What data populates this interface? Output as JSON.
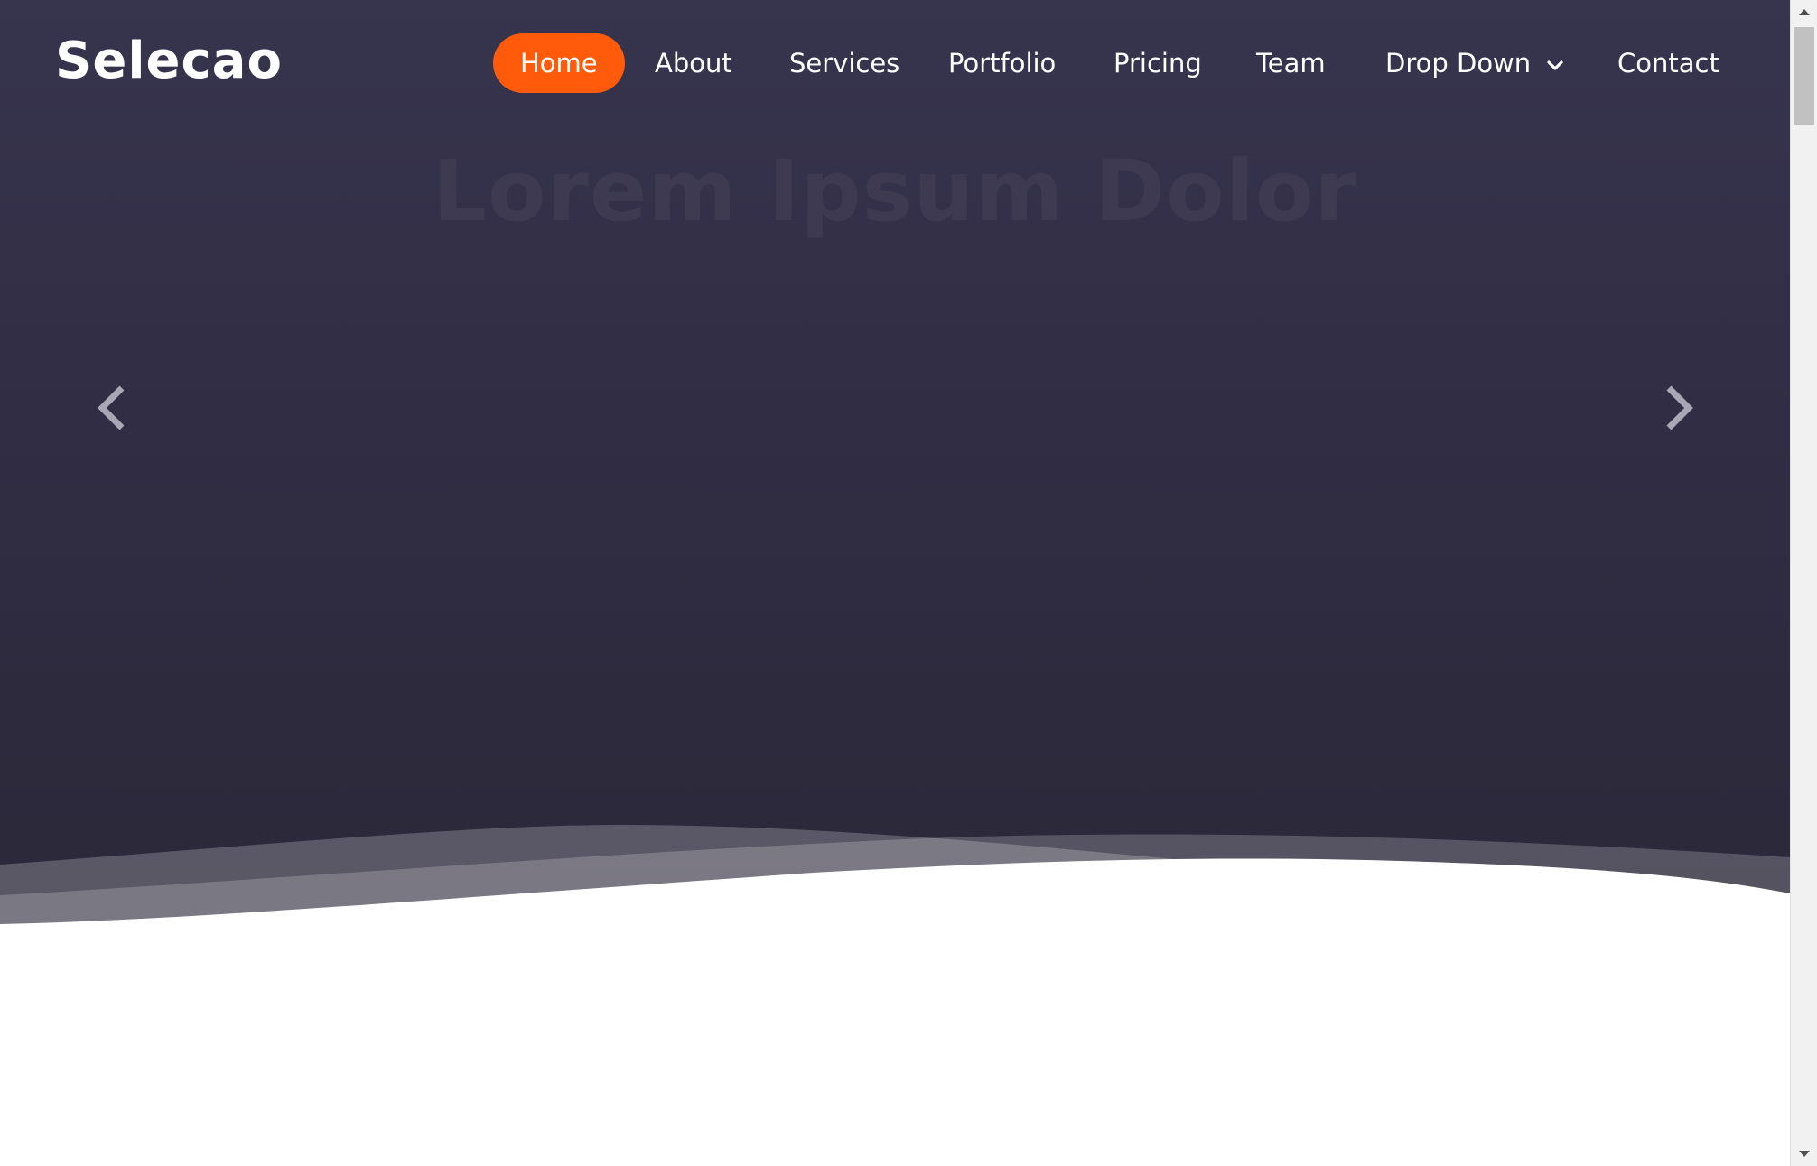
{
  "site": {
    "logo": "Selecao"
  },
  "nav": {
    "items": [
      {
        "label": "Home",
        "active": true
      },
      {
        "label": "About"
      },
      {
        "label": "Services"
      },
      {
        "label": "Portfolio"
      },
      {
        "label": "Pricing"
      },
      {
        "label": "Team"
      },
      {
        "label": "Drop Down",
        "has_dropdown": true
      },
      {
        "label": "Contact"
      }
    ]
  },
  "hero": {
    "title": "Lorem Ipsum Dolor",
    "prev_icon": "chevron-left-icon",
    "next_icon": "chevron-right-icon"
  },
  "colors": {
    "accent": "#ff5b0a",
    "hero_top": "#37344e",
    "hero_bottom": "#2b2839",
    "text": "#ffffff"
  }
}
